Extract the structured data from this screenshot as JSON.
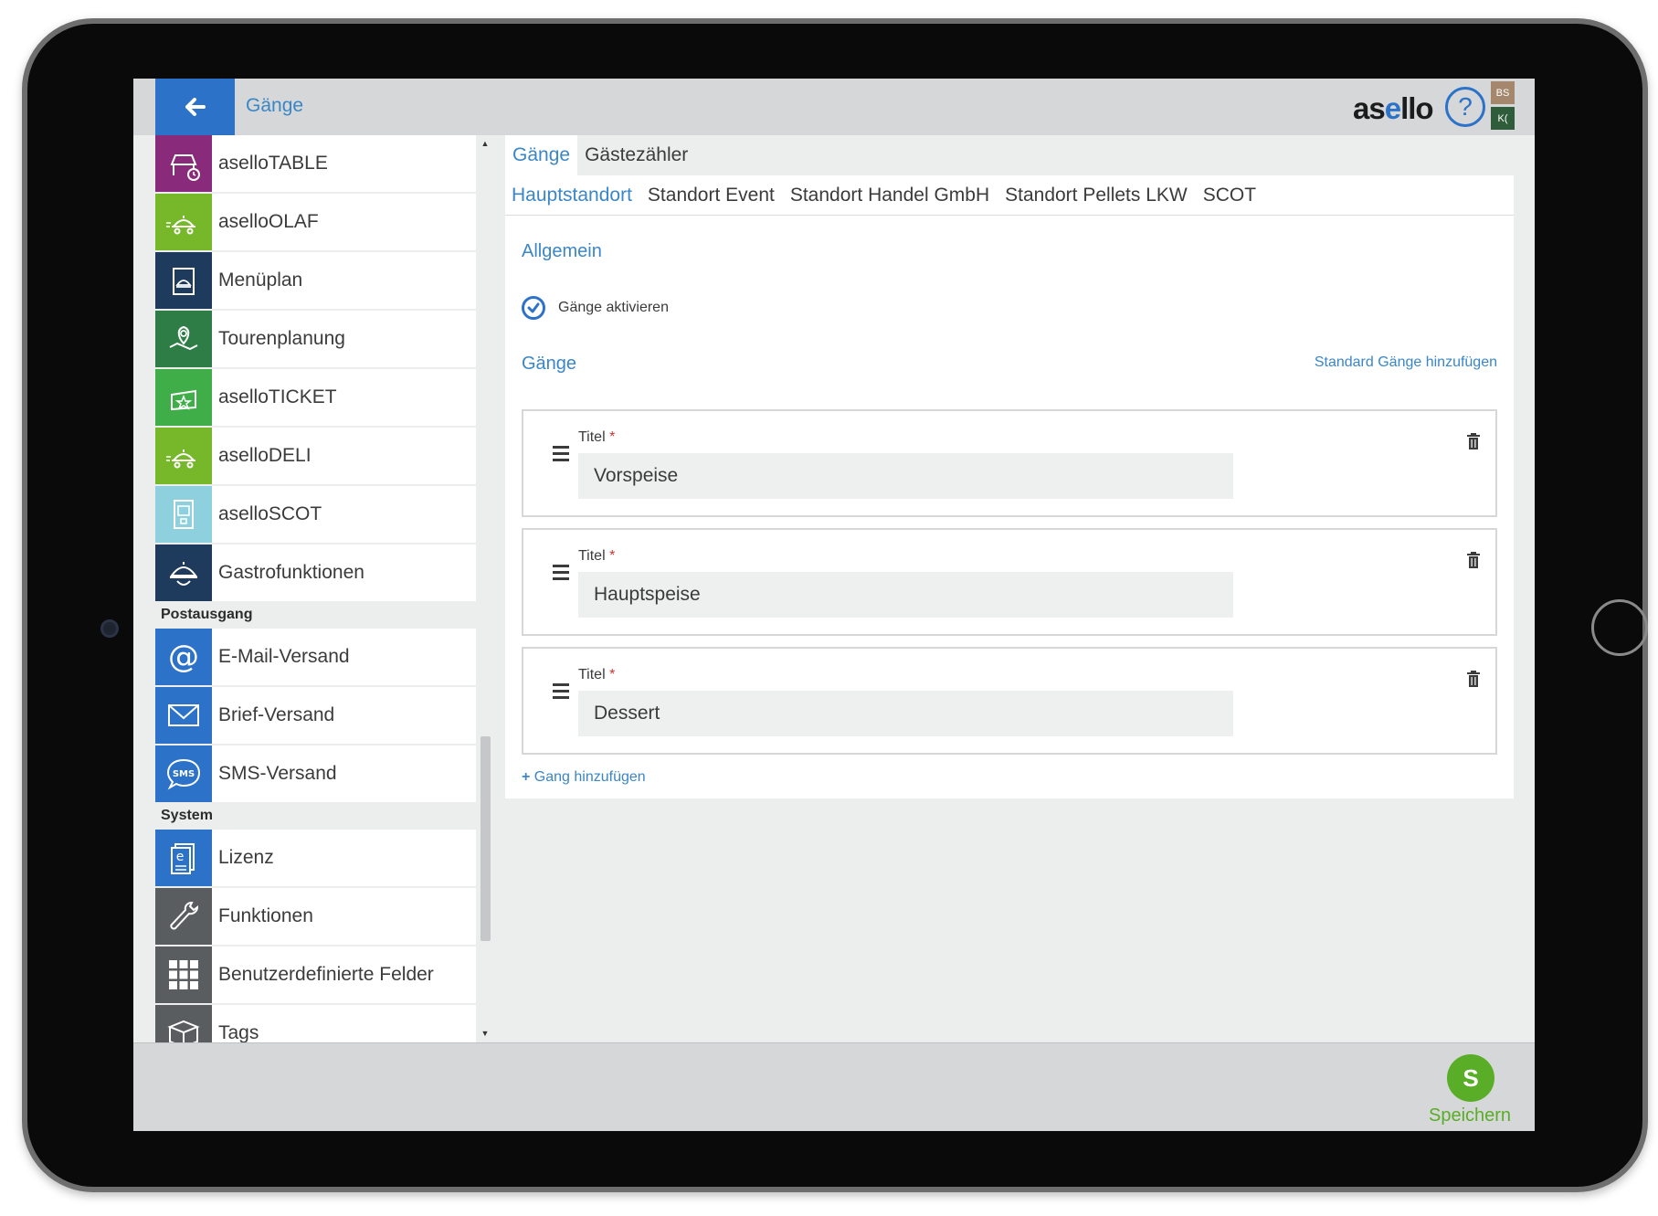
{
  "header": {
    "title": "Gänge",
    "brand_prefix": "as",
    "brand_e": "e",
    "brand_suffix": "llo",
    "help_symbol": "?",
    "badge_top": "BS",
    "badge_bottom": "K("
  },
  "sidebar": {
    "items_top": [
      {
        "label": "aselloTABLE",
        "color": "#8a2a7b",
        "icon": "table-clock-icon"
      },
      {
        "label": "aselloOLAF",
        "color": "#76b82a",
        "icon": "delivery-cart-icon"
      },
      {
        "label": "Menüplan",
        "color": "#1e3a5c",
        "icon": "menu-card-icon"
      },
      {
        "label": "Tourenplanung",
        "color": "#2e7d46",
        "icon": "map-pin-icon"
      },
      {
        "label": "aselloTICKET",
        "color": "#3fae49",
        "icon": "ticket-icon"
      },
      {
        "label": "aselloDELI",
        "color": "#76b82a",
        "icon": "delivery-cart-icon"
      },
      {
        "label": "aselloSCOT",
        "color": "#8fd0df",
        "icon": "kiosk-icon"
      },
      {
        "label": "Gastrofunktionen",
        "color": "#1e3a5c",
        "icon": "cloche-icon"
      }
    ],
    "section_post": "Postausgang",
    "items_post": [
      {
        "label": "E-Mail-Versand",
        "color": "#2b72c8",
        "icon": "at-icon"
      },
      {
        "label": "Brief-Versand",
        "color": "#2b72c8",
        "icon": "envelope-icon"
      },
      {
        "label": "SMS-Versand",
        "color": "#2b72c8",
        "icon": "sms-icon"
      }
    ],
    "section_system": "System",
    "items_system": [
      {
        "label": "Lizenz",
        "color": "#2b72c8",
        "icon": "license-icon"
      },
      {
        "label": "Funktionen",
        "color": "#5a5d60",
        "icon": "wrench-icon"
      },
      {
        "label": "Benutzerdefinierte Felder",
        "color": "#5a5d60",
        "icon": "grid-icon"
      },
      {
        "label": "Tags",
        "color": "#5a5d60",
        "icon": "tag-icon"
      }
    ]
  },
  "tabs": {
    "top": [
      "Gänge",
      "Gästezähler"
    ],
    "locations": [
      "Hauptstandort",
      "Standort Event",
      "Standort Handel GmbH",
      "Standort Pellets LKW",
      "SCOT"
    ]
  },
  "main": {
    "section_general": "Allgemein",
    "activate_label": "Gänge aktivieren",
    "section_courses": "Gänge",
    "std_link": "Standard Gänge hinzufügen",
    "field_label": "Titel",
    "required_mark": "*",
    "courses": [
      "Vorspeise",
      "Hauptspeise",
      "Dessert"
    ],
    "add_link": "Gang hinzufügen",
    "add_symbol": "+"
  },
  "footer": {
    "save_letter": "S",
    "save_label": "Speichern"
  },
  "colors": {
    "accent": "#2b72c8",
    "link": "#3a86c6",
    "save": "#5aad27"
  }
}
